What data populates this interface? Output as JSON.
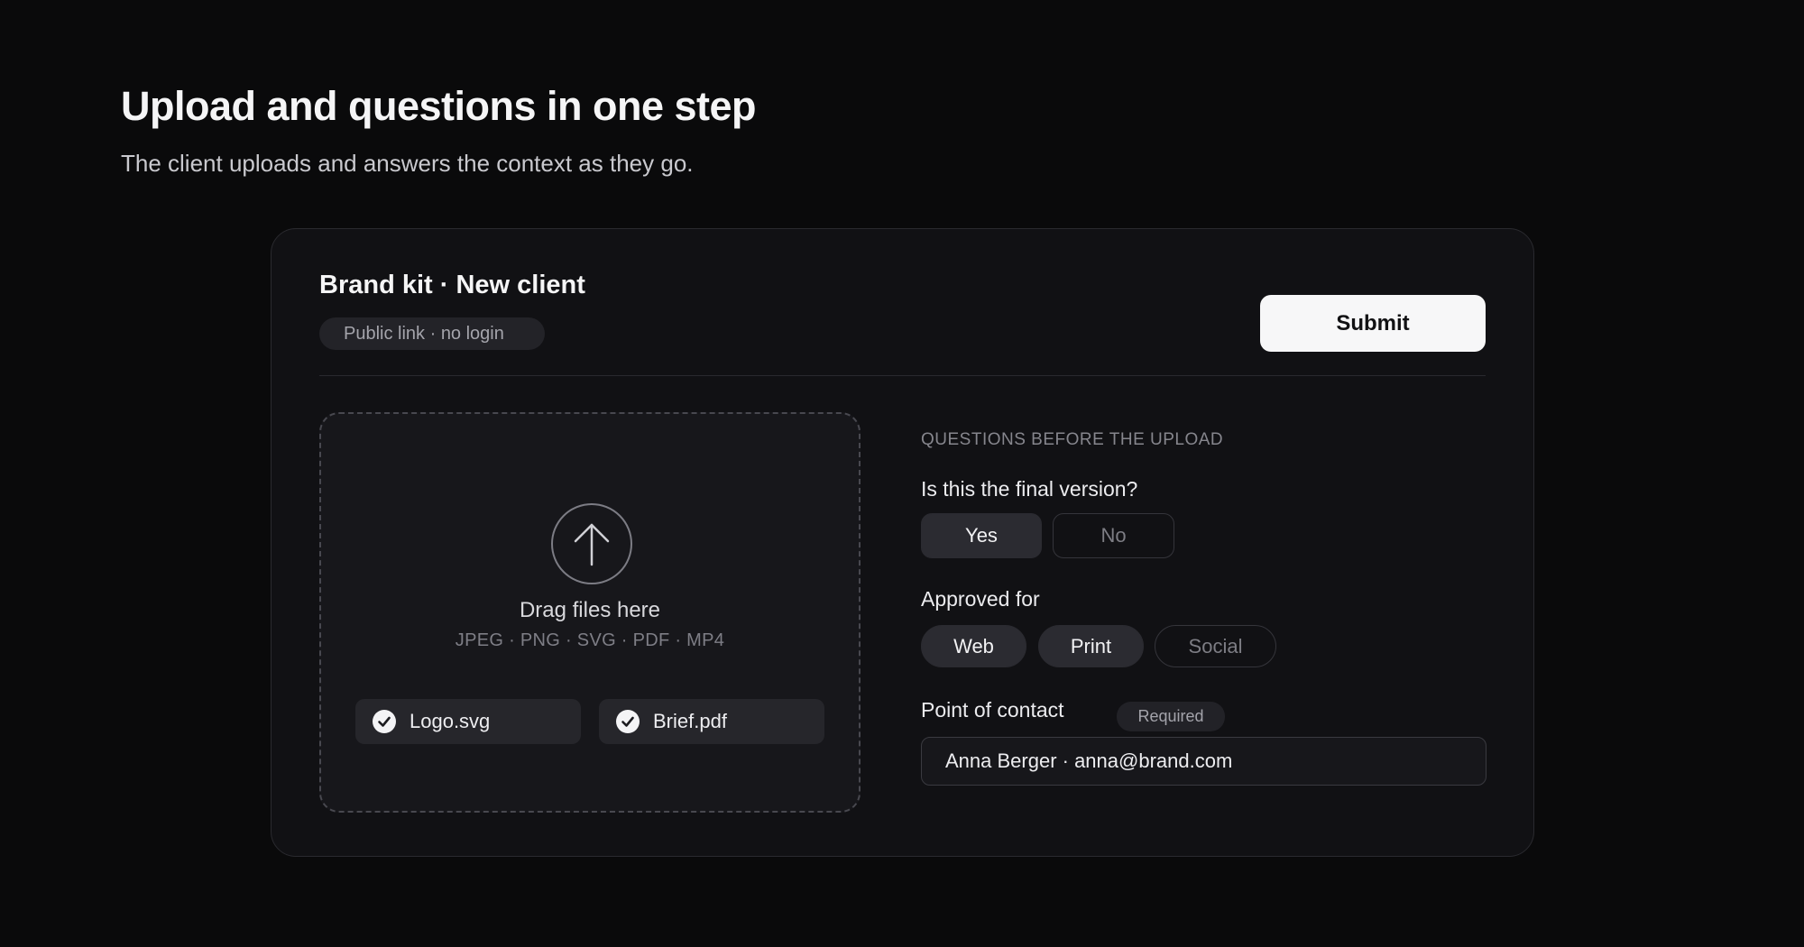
{
  "hero": {
    "title": "Upload and questions in one step",
    "subtitle": "The client uploads and answers the context as they go."
  },
  "card": {
    "title": "Brand kit · New client",
    "access_pill": "Public link · no login",
    "submit_label": "Submit"
  },
  "upload": {
    "icon": "arrow-up-icon",
    "drag_text": "Drag files here",
    "formats": "JPEG · PNG · SVG · PDF · MP4",
    "files": [
      {
        "name": "Logo.svg",
        "status_icon": "check-circle-icon"
      },
      {
        "name": "Brief.pdf",
        "status_icon": "check-circle-icon"
      }
    ]
  },
  "questions": {
    "section_label": "QUESTIONS BEFORE THE UPLOAD",
    "final_version": {
      "label": "Is this the final version?",
      "options": [
        "Yes",
        "No"
      ],
      "selected": "Yes"
    },
    "approved_for": {
      "label": "Approved for",
      "options": [
        "Web",
        "Print",
        "Social"
      ],
      "selected": [
        "Web",
        "Print"
      ]
    },
    "contact": {
      "label": "Point of contact",
      "badge": "Required",
      "value": "Anna Berger · anna@brand.com"
    }
  },
  "colors": {
    "background": "#0a0a0b",
    "card": "#111114",
    "selected_option": "#2b2b31",
    "submit_button": "#f7f7f8"
  }
}
